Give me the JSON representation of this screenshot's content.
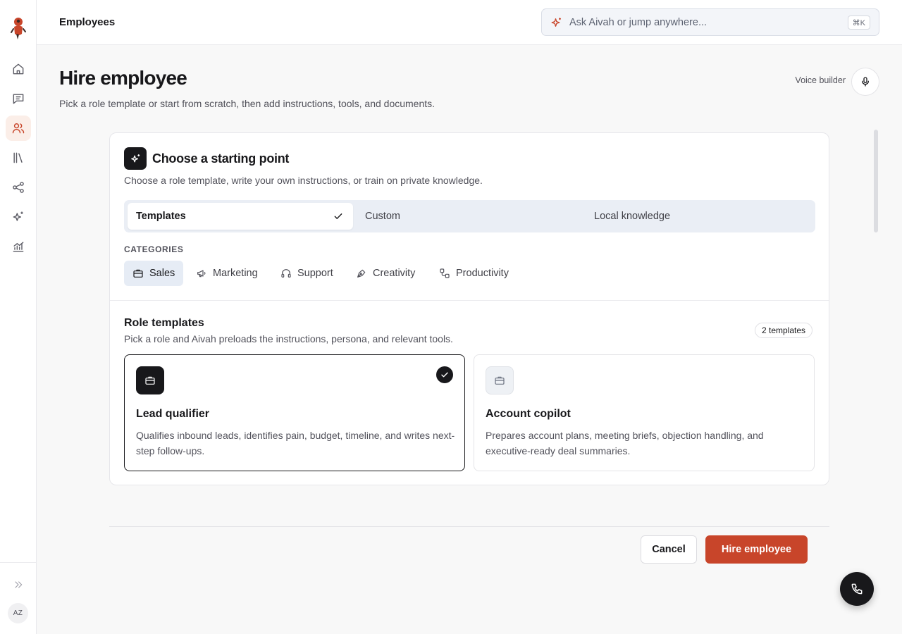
{
  "sidebar": {
    "logo_icon": "mascot-logo",
    "items": [
      {
        "icon": "home-icon",
        "active": false
      },
      {
        "icon": "chat-icon",
        "active": false
      },
      {
        "icon": "users-icon",
        "active": true
      },
      {
        "icon": "library-icon",
        "active": false
      },
      {
        "icon": "share-icon",
        "active": false
      },
      {
        "icon": "sparkle-icon",
        "active": false
      },
      {
        "icon": "chart-icon",
        "active": false
      }
    ],
    "expand_icon": "chevrons-right-icon",
    "avatar_initials": "AZ"
  },
  "topbar": {
    "title": "Employees",
    "search_placeholder": "Ask Aivah or jump anywhere...",
    "search_shortcut": "⌘K"
  },
  "page": {
    "title": "Hire employee",
    "subtitle": "Pick a role template or start from scratch, then add instructions, tools, and documents.",
    "voice_builder_label": "Voice builder"
  },
  "starting_point": {
    "title": "Choose a starting point",
    "subtitle": "Choose a role template, write your own instructions, or train on private knowledge.",
    "tabs": [
      {
        "label": "Templates",
        "selected": true
      },
      {
        "label": "Custom",
        "selected": false
      },
      {
        "label": "Local knowledge",
        "selected": false
      }
    ],
    "categories_heading": "CATEGORIES",
    "categories": [
      {
        "label": "Sales",
        "icon": "briefcase-icon",
        "selected": true
      },
      {
        "label": "Marketing",
        "icon": "megaphone-icon",
        "selected": false
      },
      {
        "label": "Support",
        "icon": "headphones-icon",
        "selected": false
      },
      {
        "label": "Creativity",
        "icon": "pen-icon",
        "selected": false
      },
      {
        "label": "Productivity",
        "icon": "workflow-icon",
        "selected": false
      }
    ]
  },
  "role_templates": {
    "title": "Role templates",
    "subtitle": "Pick a role and Aivah preloads the instructions, persona, and relevant tools.",
    "count_badge": "2 templates",
    "items": [
      {
        "name": "Lead qualifier",
        "description": "Qualifies inbound leads, identifies pain, budget, timeline, and writes next-step follow-ups.",
        "selected": true
      },
      {
        "name": "Account copilot",
        "description": "Prepares account plans, meeting briefs, objection handling, and executive-ready deal summaries.",
        "selected": false
      }
    ]
  },
  "actions": {
    "cancel_label": "Cancel",
    "hire_label": "Hire employee"
  },
  "colors": {
    "accent": "#c8452a",
    "dark": "#18181b"
  }
}
